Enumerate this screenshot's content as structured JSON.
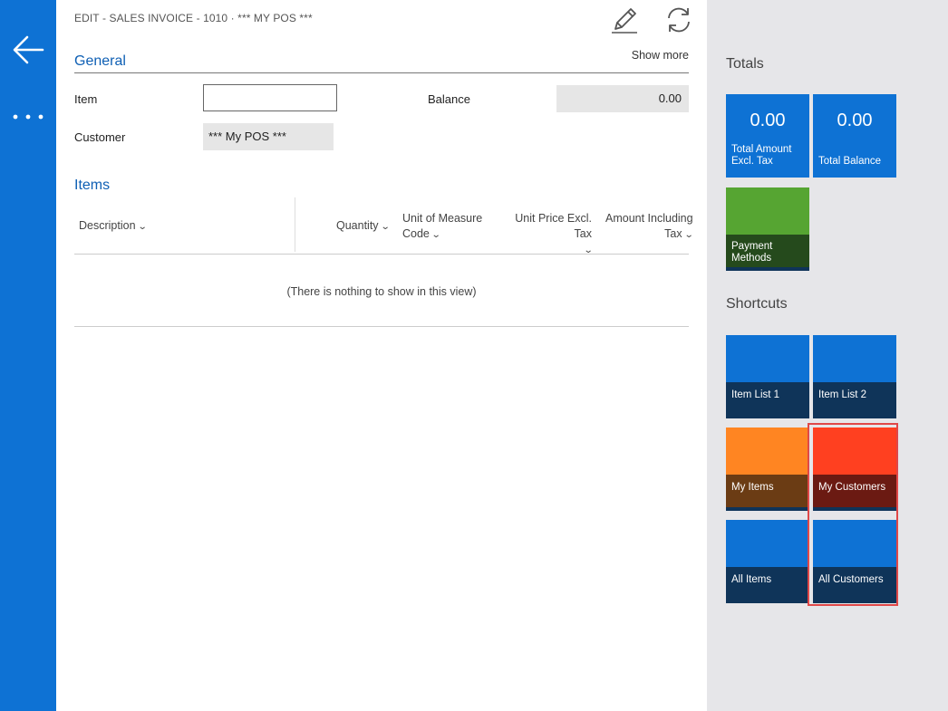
{
  "header": {
    "breadcrumb": "EDIT - SALES INVOICE - 1010 · *** MY POS ***",
    "show_more": "Show more"
  },
  "general": {
    "title": "General",
    "item_label": "Item",
    "item_value": "",
    "customer_label": "Customer",
    "customer_value": "*** My POS ***",
    "balance_label": "Balance",
    "balance_value": "0.00"
  },
  "items": {
    "title": "Items",
    "columns": {
      "description": "Description",
      "quantity": "Quantity",
      "uom_line1": "Unit of Measure",
      "uom_line2": "Code",
      "price": "Unit Price Excl. Tax",
      "amount_line1": "Amount Including",
      "amount_line2": "Tax"
    },
    "empty_message": "(There is nothing to show in this view)"
  },
  "factbox": {
    "totals_heading": "Totals",
    "total_amount": {
      "value": "0.00",
      "label_line1": "Total Amount",
      "label_line2": "Excl. Tax"
    },
    "total_balance": {
      "value": "0.00",
      "label": "Total Balance"
    },
    "payment_methods": {
      "label_line1": "Payment",
      "label_line2": "Methods"
    },
    "shortcuts_heading": "Shortcuts",
    "shortcuts": {
      "item_list_1": "Item List 1",
      "item_list_2": "Item List 2",
      "my_items": "My Items",
      "my_customers": "My Customers",
      "all_items": "All Items",
      "all_customers": "All Customers"
    }
  },
  "icons": {
    "back": "arrow-left-icon",
    "more": "ellipsis-icon",
    "edit": "pencil-icon",
    "refresh": "refresh-icon"
  },
  "colors": {
    "accent_blue": "#0e72d4",
    "tile_green": "#56a532",
    "tile_orange": "#ff8522",
    "tile_red": "#ff4020",
    "highlight": "#e04848"
  }
}
